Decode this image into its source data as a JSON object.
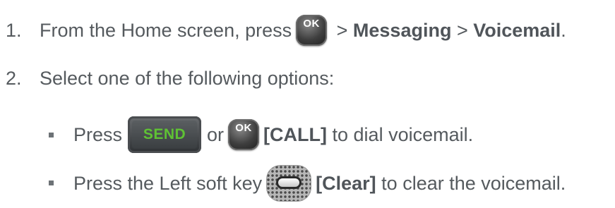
{
  "steps": [
    {
      "number": "1.",
      "pre": "From the Home screen, press",
      "key": "OK",
      "sep1": " > ",
      "bold1": "Messaging",
      "sep2": " > ",
      "bold2": "Voicemail",
      "end": "."
    },
    {
      "number": "2.",
      "text": "Select one of the following options:"
    }
  ],
  "options": [
    {
      "pre": "Press",
      "send_key": "SEND",
      "or": "or",
      "ok_key": "OK",
      "bold": "[CALL]",
      "post": " to dial voicemail."
    },
    {
      "pre": "Press the Left soft key",
      "soft_key_icon": "left-soft-key-icon",
      "bold": "[Clear]",
      "post": " to clear the voicemail."
    }
  ]
}
